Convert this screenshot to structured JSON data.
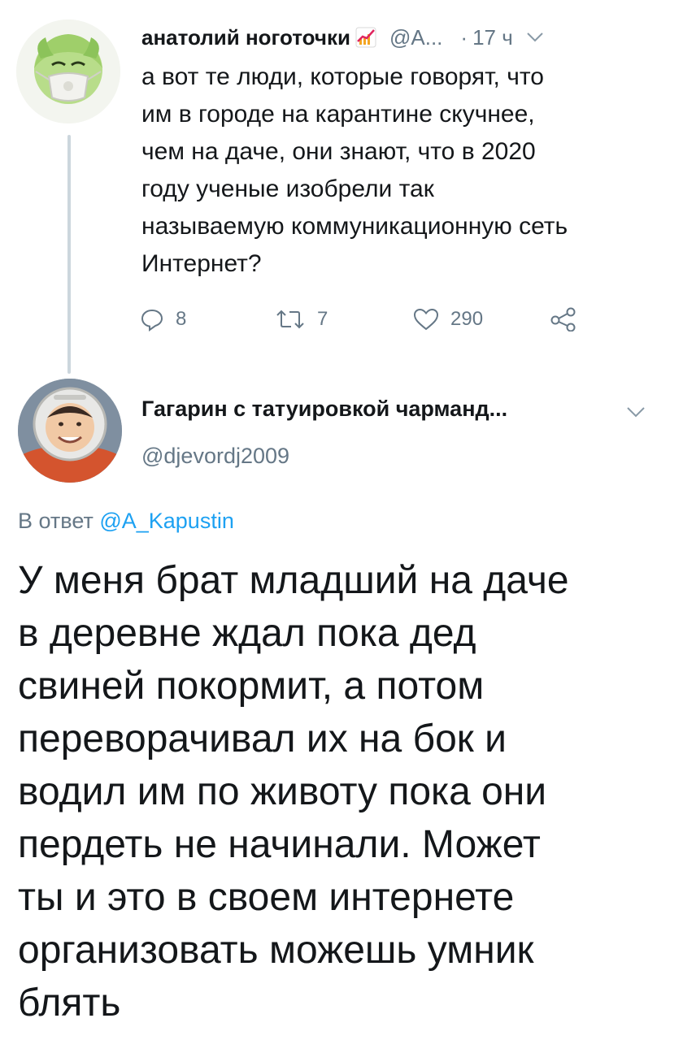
{
  "tweet1": {
    "author_name": "анатолий ноготочки",
    "author_handle": "@А...",
    "time": "17 ч",
    "separator": "·",
    "text": "а вот те люди, которые говорят, что\nим в городе на карантине скучнее,\nчем на даче, они знают, что в 2020\nгоду ученые изобрели так\nназываемую коммуникационную сеть\nИнтернет?",
    "reply_count": "8",
    "retweet_count": "7",
    "like_count": "290"
  },
  "tweet2": {
    "author_name": "Гагарин с татуировкой чарманд...",
    "author_handle": "@djevordj2009",
    "reply_prefix": "В ответ ",
    "reply_mention": "@A_Kapustin",
    "text": "У меня брат младший на даче\nв деревне ждал пока дед\nсвиней покормит, а потом\nпереворачивал их на бок и\nводил им по животу пока они\nпердеть не начинали. Может\nты и это в своем интернете\nорганизовать можешь умник\nблять"
  },
  "icons": {
    "reply": "reply-icon",
    "retweet": "retweet-icon",
    "like": "like-icon",
    "share": "share-icon",
    "more": "chevron-down-icon",
    "name_emoji": "chart-increasing-icon"
  },
  "colors": {
    "text": "#14171a",
    "secondary": "#657786",
    "link": "#1da1f2",
    "thread_line": "#ccd6dd"
  }
}
